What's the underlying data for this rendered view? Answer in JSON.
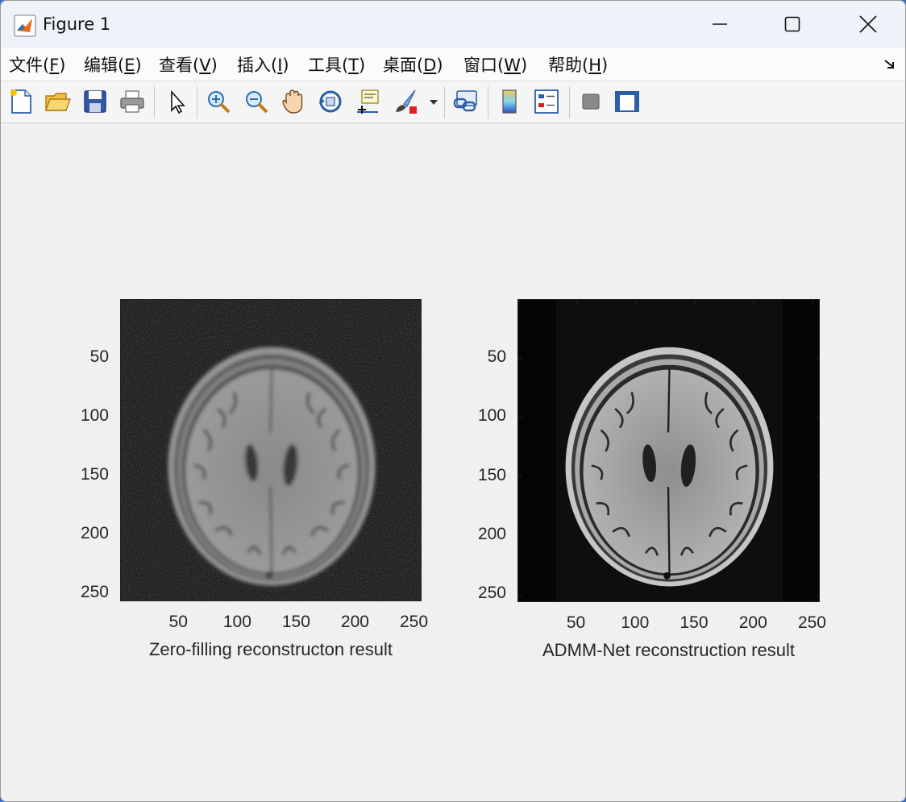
{
  "window": {
    "title": "Figure 1"
  },
  "menu": [
    {
      "label": "文件(",
      "key": "F",
      "tail": ")"
    },
    {
      "label": "编辑(",
      "key": "E",
      "tail": ")"
    },
    {
      "label": "查看(",
      "key": "V",
      "tail": ")"
    },
    {
      "label": "插入(",
      "key": "I",
      "tail": ")"
    },
    {
      "label": "工具(",
      "key": "T",
      "tail": ")"
    },
    {
      "label": "桌面(",
      "key": "D",
      "tail": ")"
    },
    {
      "label": "窗口(",
      "key": "W",
      "tail": ")"
    },
    {
      "label": "帮助(",
      "key": "H",
      "tail": ")"
    }
  ],
  "toolbar_icons": [
    "new-figure-icon",
    "open-file-icon",
    "save-icon",
    "print-icon",
    "select-arrow-icon",
    "zoom-in-icon",
    "zoom-out-icon",
    "pan-hand-icon",
    "rotate-3d-icon",
    "data-cursor-icon",
    "brush-icon",
    "link-plot-icon",
    "colorbar-icon",
    "legend-icon",
    "hide-plot-tools-icon",
    "show-plot-tools-icon"
  ],
  "plots": [
    {
      "xlabel": "Zero-filling reconstructon result",
      "xticks": [
        "50",
        "100",
        "150",
        "200",
        "250"
      ],
      "yticks": [
        "50",
        "100",
        "150",
        "200",
        "250"
      ],
      "colormap": "gray"
    },
    {
      "xlabel": "ADMM-Net reconstruction result",
      "xticks": [
        "50",
        "100",
        "150",
        "200",
        "250"
      ],
      "yticks": [
        "50",
        "100",
        "150",
        "200",
        "250"
      ],
      "colormap": "gray"
    }
  ]
}
